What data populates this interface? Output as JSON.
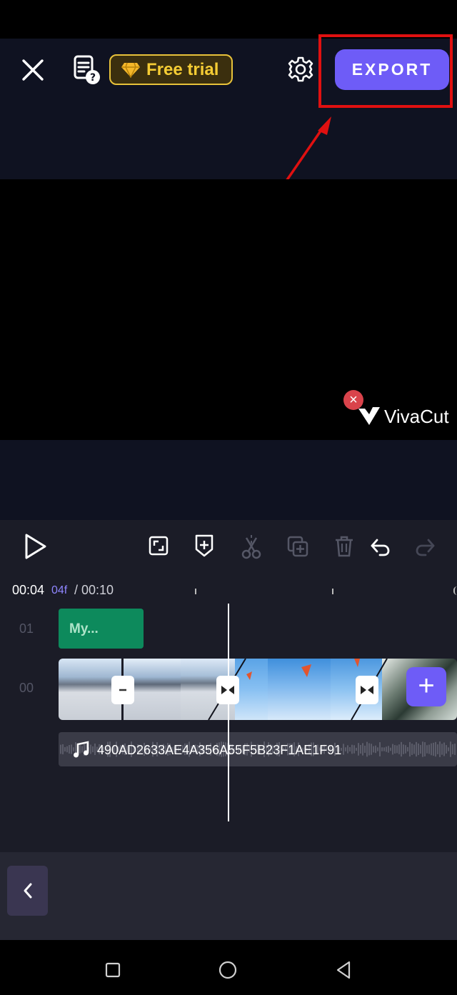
{
  "header": {
    "free_trial_label": "Free trial",
    "export_label": "EXPORT"
  },
  "preview": {
    "watermark_close": "×",
    "watermark_text": "VivaCut"
  },
  "timeline": {
    "time_current": "00:04",
    "time_frames": "04f",
    "time_total": "/ 00:10",
    "track_numbers": [
      "01",
      "00"
    ],
    "text_clip_label": "My...",
    "audio_label": "490AD2633AE4A356A55F5B23F1AE1F91",
    "add_clip_label": "+"
  },
  "colors": {
    "accent": "#6e5cf7",
    "highlight": "#e01010",
    "text_clip": "#0d8a5c"
  }
}
